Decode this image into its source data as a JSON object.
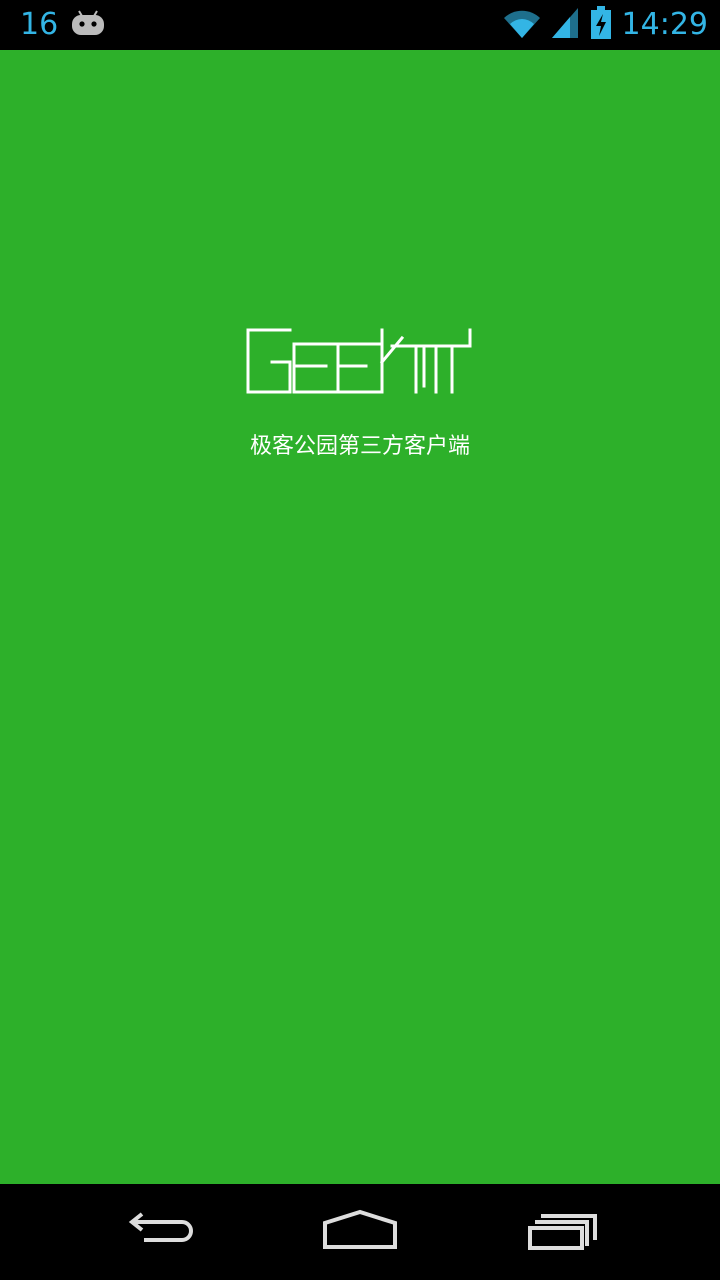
{
  "status_bar": {
    "notification_count": "16",
    "time": "14:29"
  },
  "splash": {
    "logo_alt": "GEEKPK",
    "tagline": "极客公园第三方客户端",
    "background_color": "#2db02a"
  },
  "icons": {
    "notification": "android-icon",
    "wifi": "wifi-icon",
    "signal": "signal-icon",
    "battery": "battery-charging-icon",
    "back": "back-icon",
    "home": "home-icon",
    "recents": "recents-icon"
  }
}
